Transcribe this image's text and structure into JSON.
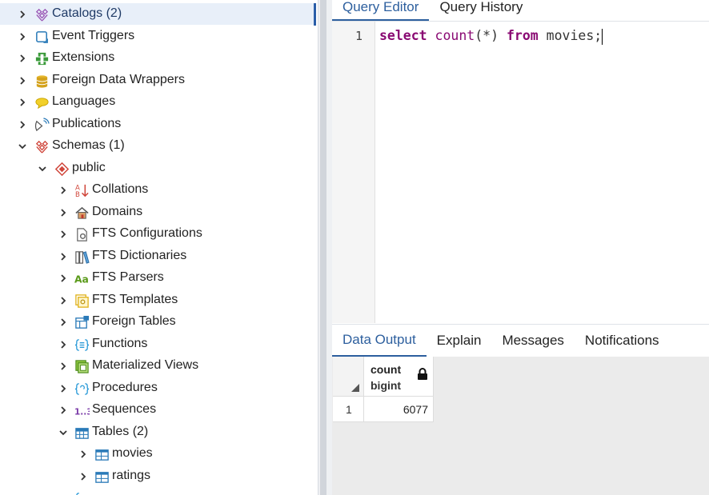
{
  "tree": {
    "items": [
      {
        "label": "Catalogs (2)",
        "icon": "catalogs-icon",
        "state": "collapsed",
        "selected": true
      },
      {
        "label": "Event Triggers",
        "icon": "event-triggers-icon",
        "state": "collapsed"
      },
      {
        "label": "Extensions",
        "icon": "extensions-icon",
        "state": "collapsed"
      },
      {
        "label": "Foreign Data Wrappers",
        "icon": "foreign-data-wrappers-icon",
        "state": "collapsed"
      },
      {
        "label": "Languages",
        "icon": "languages-icon",
        "state": "collapsed"
      },
      {
        "label": "Publications",
        "icon": "publications-icon",
        "state": "collapsed"
      },
      {
        "label": "Schemas (1)",
        "icon": "schemas-icon",
        "state": "expanded"
      },
      {
        "label": "public",
        "icon": "schema-public-icon",
        "state": "expanded"
      },
      {
        "label": "Collations",
        "icon": "collations-icon",
        "state": "collapsed"
      },
      {
        "label": "Domains",
        "icon": "domains-icon",
        "state": "collapsed"
      },
      {
        "label": "FTS Configurations",
        "icon": "fts-configurations-icon",
        "state": "collapsed"
      },
      {
        "label": "FTS Dictionaries",
        "icon": "fts-dictionaries-icon",
        "state": "collapsed"
      },
      {
        "label": "FTS Parsers",
        "icon": "fts-parsers-icon",
        "state": "collapsed"
      },
      {
        "label": "FTS Templates",
        "icon": "fts-templates-icon",
        "state": "collapsed"
      },
      {
        "label": "Foreign Tables",
        "icon": "foreign-tables-icon",
        "state": "collapsed"
      },
      {
        "label": "Functions",
        "icon": "functions-icon",
        "state": "collapsed"
      },
      {
        "label": "Materialized Views",
        "icon": "materialized-views-icon",
        "state": "collapsed"
      },
      {
        "label": "Procedures",
        "icon": "procedures-icon",
        "state": "collapsed"
      },
      {
        "label": "Sequences",
        "icon": "sequences-icon",
        "state": "collapsed"
      },
      {
        "label": "Tables (2)",
        "icon": "tables-icon",
        "state": "expanded"
      },
      {
        "label": "movies",
        "icon": "table-icon",
        "state": "collapsed"
      },
      {
        "label": "ratings",
        "icon": "table-icon",
        "state": "collapsed"
      }
    ]
  },
  "editor": {
    "tabs": [
      {
        "label": "Query Editor",
        "active": true
      },
      {
        "label": "Query History",
        "active": false
      }
    ],
    "line_number": "1",
    "code": {
      "kw1": "select",
      "fn": "count",
      "args": "(*)",
      "kw2": "from",
      "rest": "movies;"
    }
  },
  "results": {
    "tabs": [
      {
        "label": "Data Output",
        "active": true
      },
      {
        "label": "Explain",
        "active": false
      },
      {
        "label": "Messages",
        "active": false
      },
      {
        "label": "Notifications",
        "active": false
      }
    ],
    "columns": [
      {
        "name": "count",
        "type": "bigint"
      }
    ],
    "rows": [
      {
        "num": "1",
        "values": [
          "6077"
        ]
      }
    ]
  },
  "colors": {
    "accent": "#2d5f9e",
    "keyword": "#8a0a73",
    "selection": "#e8eff9"
  }
}
